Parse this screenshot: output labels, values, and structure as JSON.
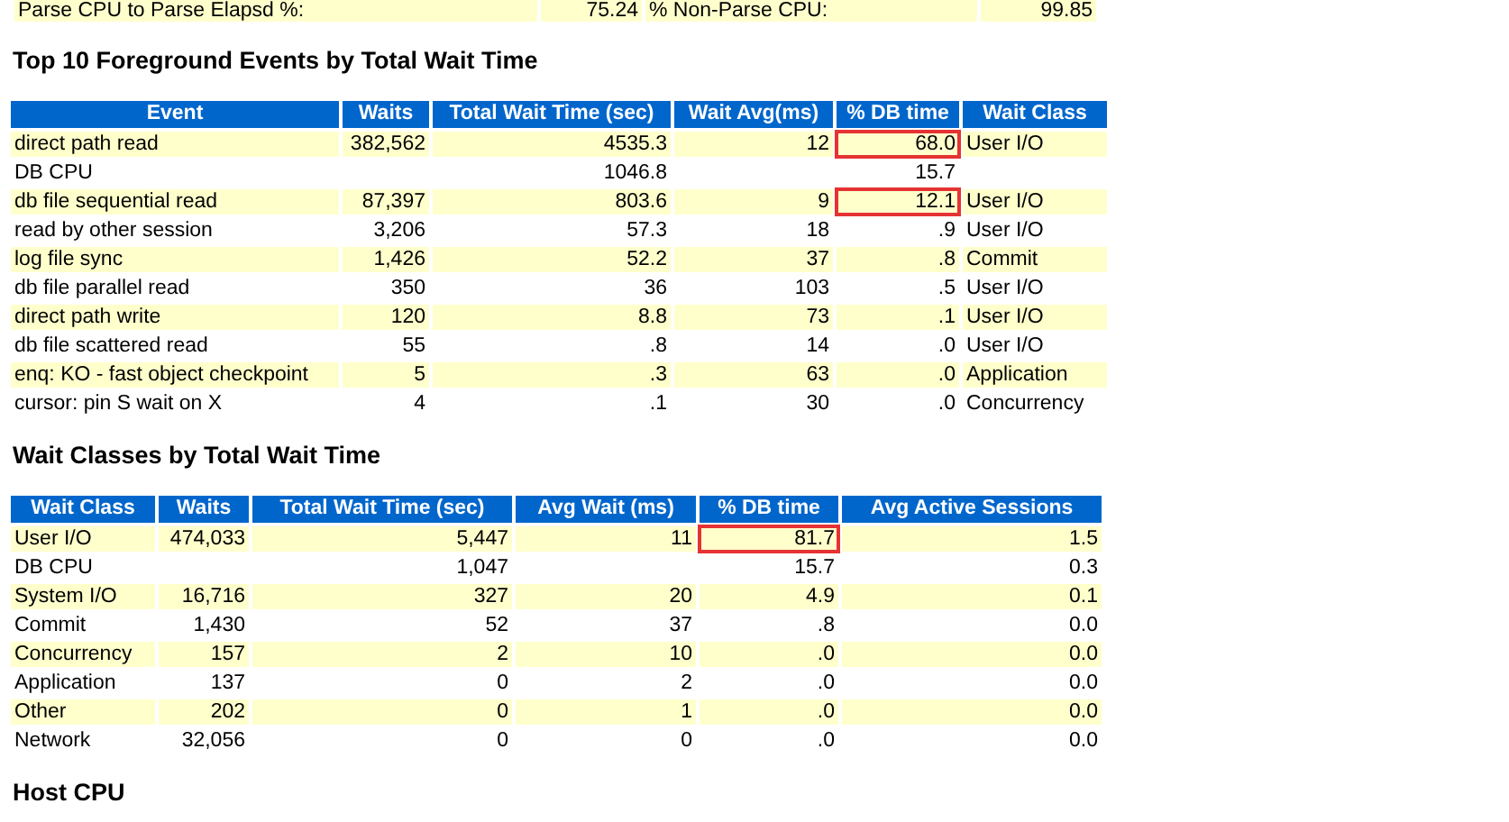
{
  "summary_row": {
    "cells": [
      "Parse CPU to Parse Elapsd %:",
      "75.24",
      "% Non-Parse CPU:",
      "99.85"
    ]
  },
  "sections": [
    {
      "title": "Top 10 Foreground Events by Total Wait Time",
      "columns": [
        "Event",
        "Waits",
        "Total Wait Time (sec)",
        "Wait Avg(ms)",
        "% DB time",
        "Wait Class"
      ],
      "rows": [
        {
          "cells": [
            "direct path read",
            "382,562",
            "4535.3",
            "12",
            {
              "text": "68.0",
              "boxed": true
            },
            "User I/O"
          ]
        },
        {
          "cells": [
            "DB CPU",
            null,
            "1046.8",
            null,
            "15.7",
            null
          ]
        },
        {
          "cells": [
            "db file sequential read",
            "87,397",
            "803.6",
            "9",
            {
              "text": "12.1",
              "boxed": true
            },
            "User I/O"
          ]
        },
        {
          "cells": [
            "read by other session",
            "3,206",
            "57.3",
            "18",
            ".9",
            "User I/O"
          ]
        },
        {
          "cells": [
            "log file sync",
            "1,426",
            "52.2",
            "37",
            ".8",
            "Commit"
          ]
        },
        {
          "cells": [
            "db file parallel read",
            "350",
            "36",
            "103",
            ".5",
            "User I/O"
          ]
        },
        {
          "cells": [
            "direct path write",
            "120",
            "8.8",
            "73",
            ".1",
            "User I/O"
          ]
        },
        {
          "cells": [
            "db file scattered read",
            "55",
            ".8",
            "14",
            ".0",
            "User I/O"
          ]
        },
        {
          "cells": [
            "enq: KO - fast object checkpoint",
            "5",
            ".3",
            "63",
            ".0",
            "Application"
          ]
        },
        {
          "cells": [
            "cursor: pin S wait on X",
            "4",
            ".1",
            "30",
            ".0",
            "Concurrency"
          ]
        }
      ]
    },
    {
      "title": "Wait Classes by Total Wait Time",
      "columns": [
        "Wait Class",
        "Waits",
        "Total Wait Time (sec)",
        "Avg Wait (ms)",
        "% DB time",
        "Avg Active Sessions"
      ],
      "rows": [
        {
          "cells": [
            "User I/O",
            "474,033",
            "5,447",
            "11",
            {
              "text": "81.7",
              "boxed": true
            },
            "1.5"
          ]
        },
        {
          "cells": [
            "DB CPU",
            null,
            "1,047",
            null,
            "15.7",
            "0.3"
          ]
        },
        {
          "cells": [
            "System I/O",
            "16,716",
            "327",
            "20",
            "4.9",
            "0.1"
          ]
        },
        {
          "cells": [
            "Commit",
            "1,430",
            "52",
            "37",
            ".8",
            "0.0"
          ]
        },
        {
          "cells": [
            "Concurrency",
            "157",
            "2",
            "10",
            ".0",
            "0.0"
          ]
        },
        {
          "cells": [
            "Application",
            "137",
            "0",
            "2",
            ".0",
            "0.0"
          ]
        },
        {
          "cells": [
            "Other",
            "202",
            "0",
            "1",
            ".0",
            "0.0"
          ]
        },
        {
          "cells": [
            "Network",
            "32,056",
            "0",
            "0",
            ".0",
            "0.0"
          ]
        }
      ]
    },
    {
      "title": "Host CPU"
    }
  ]
}
